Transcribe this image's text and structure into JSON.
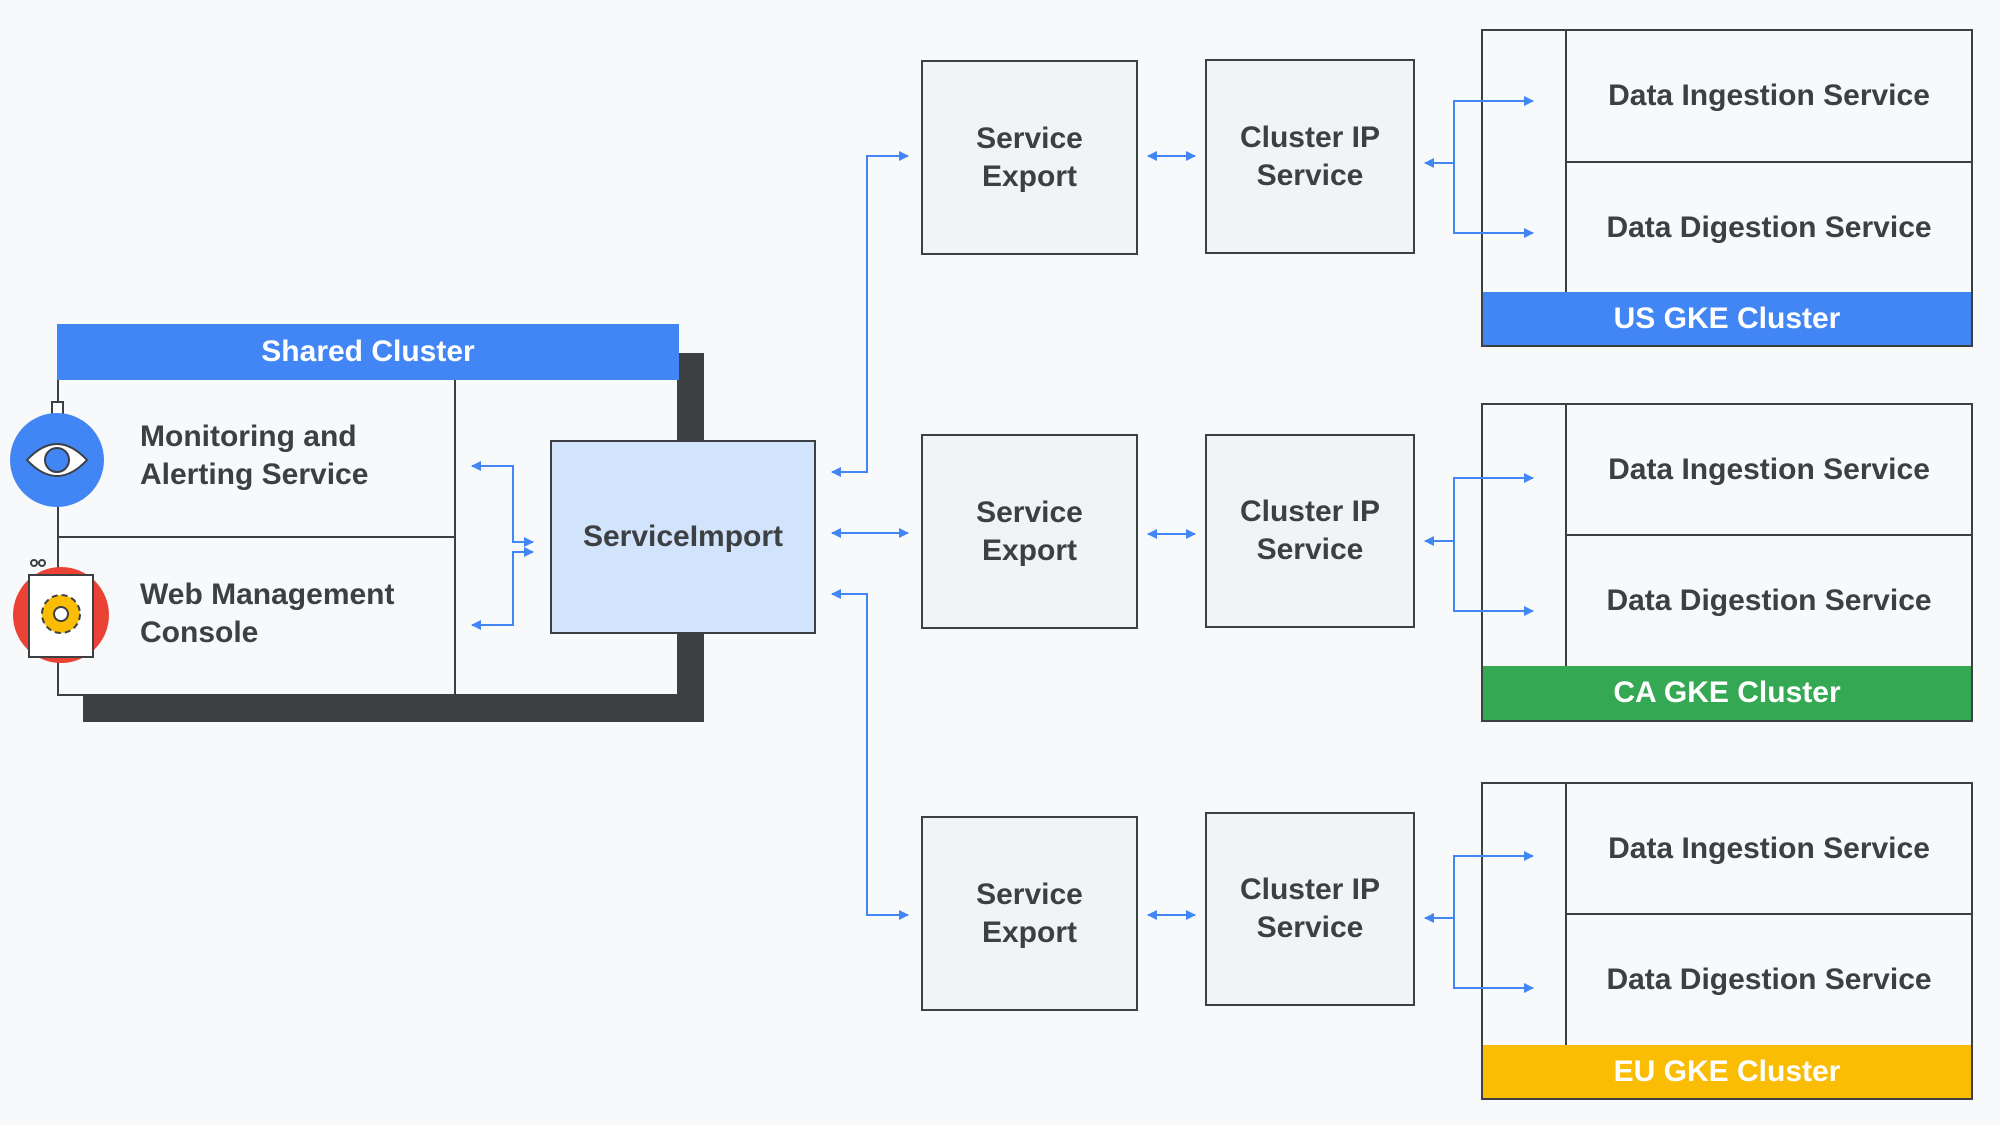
{
  "colors": {
    "accent": "#4285f4",
    "us": "#4285f4",
    "ca": "#34a853",
    "eu": "#fbbc04",
    "import_fill": "#d2e3fc",
    "border": "#3c4043",
    "arrow": "#4285f4"
  },
  "shared_cluster": {
    "title": "Shared Cluster",
    "services": [
      {
        "label_line1": "Monitoring and",
        "label_line2": "Alerting Service",
        "icon": "eye-icon"
      },
      {
        "label_line1": "Web Management",
        "label_line2": "Console",
        "icon": "gear-icon"
      }
    ],
    "service_import": "ServiceImport"
  },
  "regions": [
    {
      "service_export_line1": "Service",
      "service_export_line2": "Export",
      "cluster_ip_line1": "Cluster IP",
      "cluster_ip_line2": "Service",
      "ingestion": "Data Ingestion Service",
      "digestion": "Data Digestion Service",
      "cluster": "US GKE Cluster"
    },
    {
      "service_export_line1": "Service",
      "service_export_line2": "Export",
      "cluster_ip_line1": "Cluster IP",
      "cluster_ip_line2": "Service",
      "ingestion": "Data Ingestion Service",
      "digestion": "Data Digestion Service",
      "cluster": "CA GKE Cluster"
    },
    {
      "service_export_line1": "Service",
      "service_export_line2": "Export",
      "cluster_ip_line1": "Cluster IP",
      "cluster_ip_line2": "Service",
      "ingestion": "Data Ingestion Service",
      "digestion": "Data Digestion Service",
      "cluster": "EU GKE Cluster"
    }
  ]
}
